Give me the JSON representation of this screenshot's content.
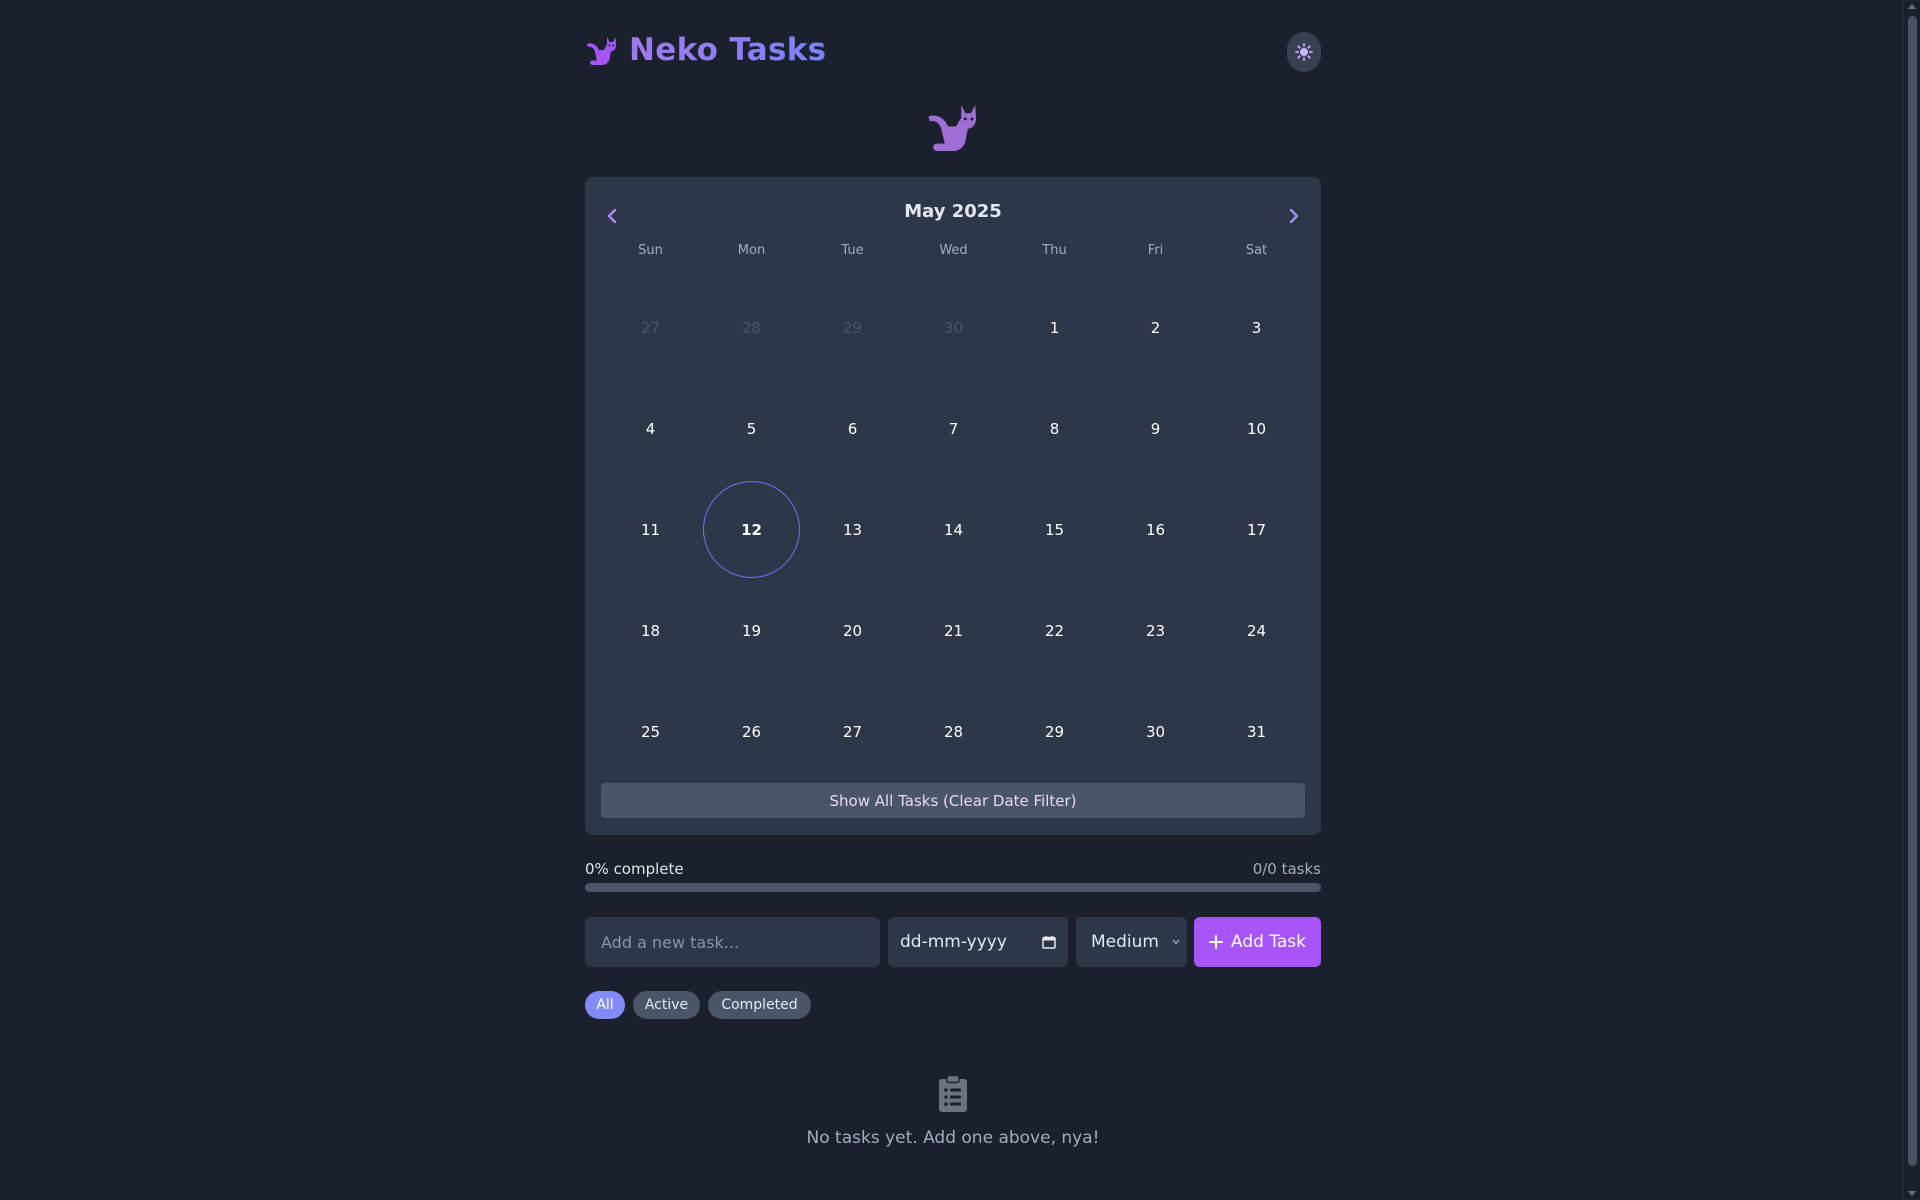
{
  "app": {
    "title": "Neko Tasks"
  },
  "colors": {
    "accent": "#a855f7",
    "brand": "#9f7aea",
    "today_ring": "#7c6cf6",
    "background": "#1a202c",
    "panel": "#2d3748"
  },
  "icons": {
    "logo": "cat-icon",
    "theme": "sun-icon",
    "mascot": "cat-icon",
    "prev": "chevron-left-icon",
    "next": "chevron-right-icon",
    "empty": "clipboard-list-icon",
    "add": "plus-icon",
    "calendar": "calendar-icon"
  },
  "calendar": {
    "month_label": "May 2025",
    "weekdays": [
      "Sun",
      "Mon",
      "Tue",
      "Wed",
      "Thu",
      "Fri",
      "Sat"
    ],
    "days": [
      {
        "label": "27",
        "muted": true
      },
      {
        "label": "28",
        "muted": true
      },
      {
        "label": "29",
        "muted": true
      },
      {
        "label": "30",
        "muted": true
      },
      {
        "label": "1"
      },
      {
        "label": "2"
      },
      {
        "label": "3"
      },
      {
        "label": "4"
      },
      {
        "label": "5"
      },
      {
        "label": "6"
      },
      {
        "label": "7"
      },
      {
        "label": "8"
      },
      {
        "label": "9"
      },
      {
        "label": "10"
      },
      {
        "label": "11"
      },
      {
        "label": "12",
        "today": true
      },
      {
        "label": "13"
      },
      {
        "label": "14"
      },
      {
        "label": "15"
      },
      {
        "label": "16"
      },
      {
        "label": "17"
      },
      {
        "label": "18"
      },
      {
        "label": "19"
      },
      {
        "label": "20"
      },
      {
        "label": "21"
      },
      {
        "label": "22"
      },
      {
        "label": "23"
      },
      {
        "label": "24"
      },
      {
        "label": "25"
      },
      {
        "label": "26"
      },
      {
        "label": "27"
      },
      {
        "label": "28"
      },
      {
        "label": "29"
      },
      {
        "label": "30"
      },
      {
        "label": "31"
      }
    ],
    "clear_label": "Show All Tasks (Clear Date Filter)"
  },
  "progress": {
    "label": "0% complete",
    "count": "0/0 tasks",
    "fraction": 0
  },
  "form": {
    "task_placeholder": "Add a new task...",
    "task_value": "",
    "date_placeholder": "dd-mm-yyyy",
    "priority_value": "Medium",
    "add_label": "Add Task"
  },
  "filters": {
    "all": "All",
    "active": "Active",
    "completed": "Completed",
    "selected": "All"
  },
  "empty": {
    "message": "No tasks yet. Add one above, nya!"
  }
}
